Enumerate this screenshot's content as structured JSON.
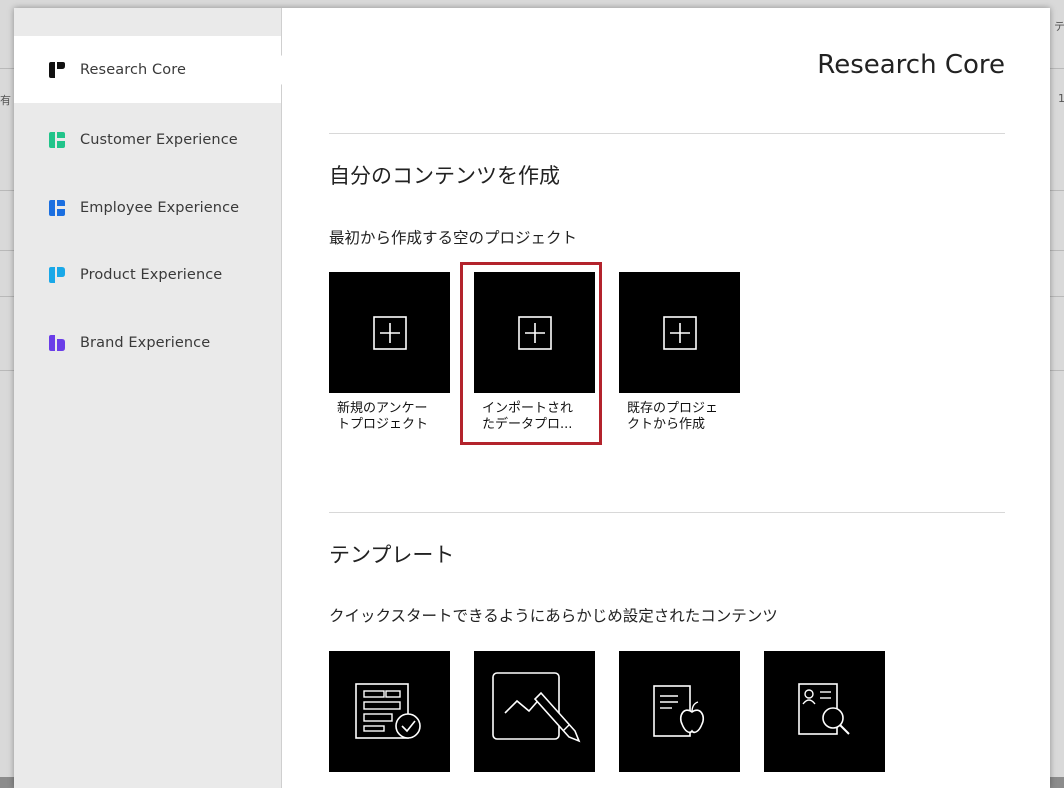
{
  "background": {
    "left_char": "有",
    "right_char_top": "テ",
    "right_char_mid": "1"
  },
  "sidebar": {
    "items": [
      {
        "label": "Research Core",
        "icon": "research-core-icon",
        "color": "#111111",
        "active": true
      },
      {
        "label": "Customer Experience",
        "icon": "customer-experience-icon",
        "color": "#21c48a",
        "active": false
      },
      {
        "label": "Employee Experience",
        "icon": "employee-experience-icon",
        "color": "#1b6fe0",
        "active": false
      },
      {
        "label": "Product Experience",
        "icon": "product-experience-icon",
        "color": "#19a8e8",
        "active": false
      },
      {
        "label": "Brand Experience",
        "icon": "brand-experience-icon",
        "color": "#6a3de8",
        "active": false
      }
    ]
  },
  "main": {
    "product_title": "Research Core",
    "create_section": {
      "title": "自分のコンテンツを作成",
      "subtitle": "最初から作成する空のプロジェクト",
      "tiles": [
        {
          "line1": "新規のアンケー",
          "line2": "トプロジェクト",
          "icon": "plus-icon"
        },
        {
          "line1": "インポートされ",
          "line2": "たデータプロ...",
          "icon": "plus-icon",
          "highlighted": true
        },
        {
          "line1": "既存のプロジェ",
          "line2": "クトから作成",
          "icon": "plus-icon"
        }
      ]
    },
    "template_section": {
      "title": "テンプレート",
      "subtitle": "クイックスタートできるようにあらかじめ設定されたコンテンツ",
      "tiles": [
        {
          "icon": "form-check-icon"
        },
        {
          "icon": "whiteboard-pen-icon"
        },
        {
          "icon": "document-apple-icon"
        },
        {
          "icon": "profile-search-icon"
        }
      ]
    }
  },
  "colors": {
    "highlight": "#b3232c",
    "tile_bg": "#000000"
  }
}
